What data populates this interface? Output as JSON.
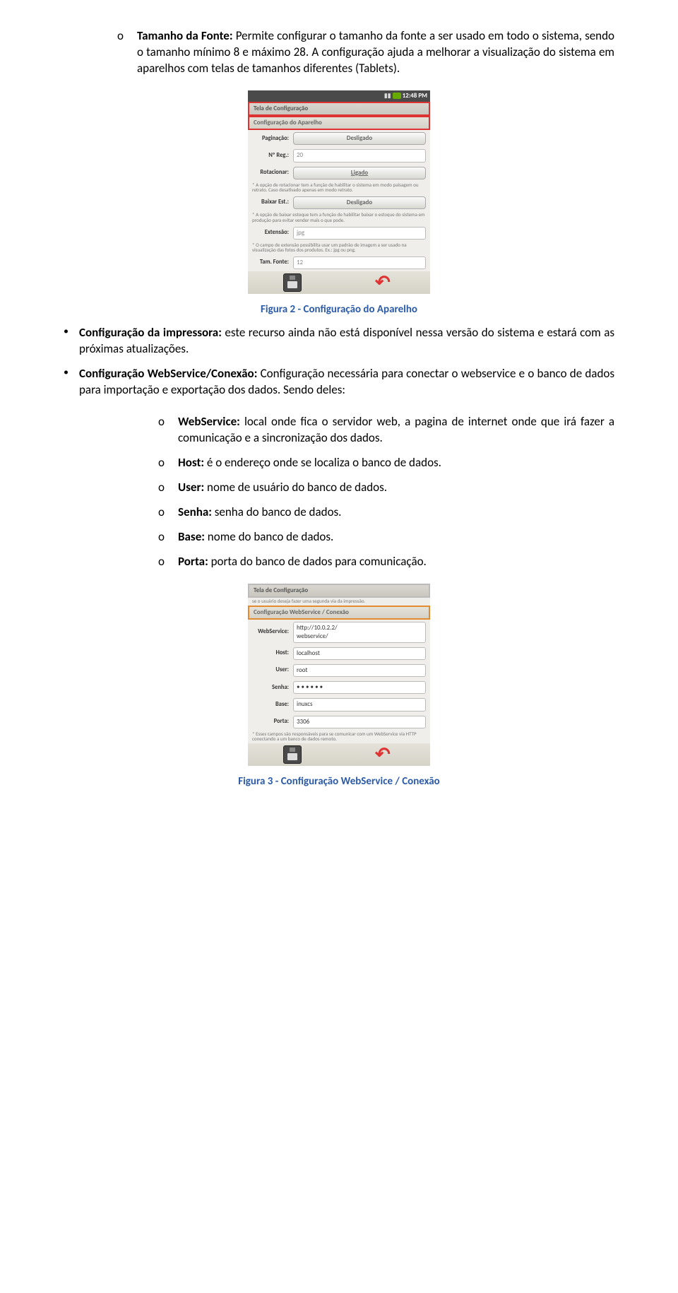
{
  "intro": {
    "bullet": "o",
    "bold": "Tamanho da Fonte:",
    "rest": " Permite configurar o tamanho da fonte a ser usado em todo o sistema, sendo o tamanho mínimo 8 e máximo 28. A configuração ajuda a melhorar a visualização do sistema em aparelhos com telas de tamanhos diferentes (Tablets)."
  },
  "shot1": {
    "statusbar_time": "12:48 PM",
    "title": "Tela de Configuração",
    "section": "Configuração do Aparelho",
    "rows": {
      "paginacao_lab": "Paginação:",
      "paginacao_val": "Desligado",
      "nreg_lab": "Nº Reg.:",
      "nreg_val": "20",
      "rotacionar_lab": "Rotacionar:",
      "rotacionar_val": "Ligado",
      "rot_note": "* A opção de rotacionar tem a função de habilitar o sistema em modo paisagem ou retrato. Caso desativado apenas em modo retrato.",
      "baixar_lab": "Baixar Est.:",
      "baixar_val": "Desligado",
      "baixar_note": "* A opção de baixar estoque tem a função de habilitar baixar o estoque do sistema em produção para evitar vender mais o que pode.",
      "ext_lab": "Extensão:",
      "ext_val": "jpg",
      "ext_note": "* O campo de extensão possibilita usar um padrão de imagem a ser usado na visualização das fotos dos produtos. Ex.: jpg ou png.",
      "tam_lab": "Tam. Fonte:",
      "tam_val": "12"
    }
  },
  "caption1": "Figura 2 - Configuração do Aparelho",
  "bullets": {
    "b1_bold": "Configuração da impressora:",
    "b1_rest": " este recurso ainda não está disponível nessa versão do sistema e estará com as próximas atualizações.",
    "b2_bold": "Configuração WebService/Conexão:",
    "b2_rest": " Configuração necessária para conectar o webservice e o banco de dados para importação e exportação dos dados. Sendo deles:"
  },
  "sub": {
    "s1_bold": "WebService:",
    "s1_rest": " local onde fica o servidor web, a pagina de internet onde que irá fazer a comunicação e a sincronização dos dados.",
    "s2_bold": "Host:",
    "s2_rest": " é o endereço onde se localiza o banco de dados.",
    "s3_bold": "User:",
    "s3_rest": " nome de usuário do banco de dados.",
    "s4_bold": "Senha:",
    "s4_rest": " senha do banco de dados.",
    "s5_bold": "Base:",
    "s5_rest": " nome do banco de dados.",
    "s6_bold": "Porta:",
    "s6_rest": " porta do banco de dados para comunicação."
  },
  "shot2": {
    "title": "Tela de Configuração",
    "subtitle": "se o usuário deseja fazer uma segunda via da impressão.",
    "section": "Configuração WebService / Conexão",
    "rows": {
      "ws_lab": "WebService:",
      "ws_val": "http://10.0.2.2/\nwebservice/",
      "host_lab": "Host:",
      "host_val": "localhost",
      "user_lab": "User:",
      "user_val": "root",
      "senha_lab": "Senha:",
      "senha_val": "• • • • • •",
      "base_lab": "Base:",
      "base_val": "inuxcs",
      "porta_lab": "Porta:",
      "porta_val": "3306",
      "note": "* Esses campos são responsáveis para se comunicar com um WebService via HTTP conectando a um banco de dados remoto."
    }
  },
  "caption2": "Figura 3 - Configuração WebService / Conexão"
}
